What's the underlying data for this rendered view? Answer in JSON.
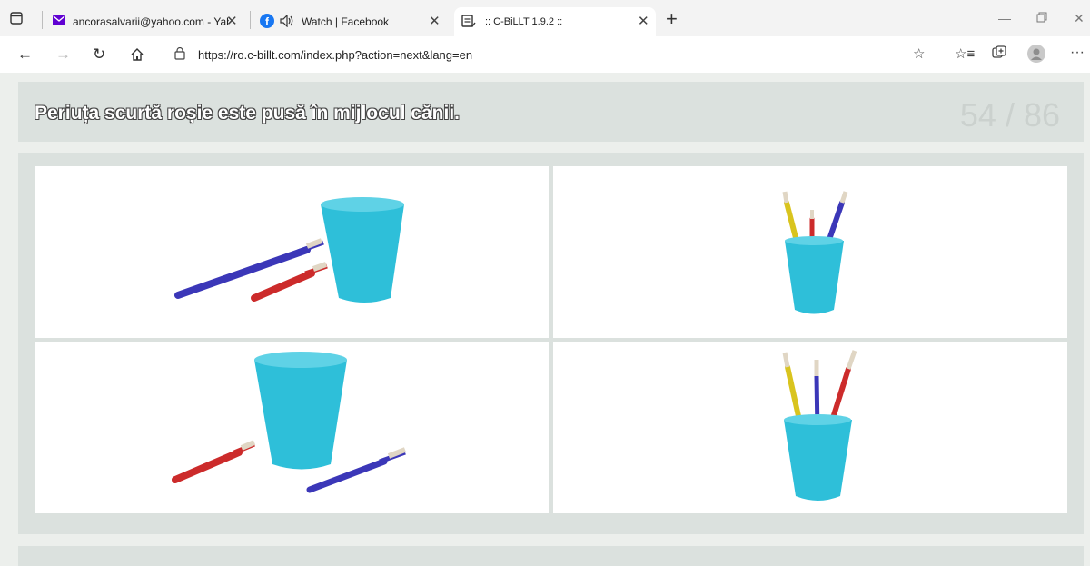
{
  "tabs": [
    {
      "label": "ancorasalvarii@yahoo.com - Yah"
    },
    {
      "label": "Watch | Facebook"
    },
    {
      "label": ":: C-BiLLT 1.9.2 ::"
    }
  ],
  "address": {
    "url": "https://ro.c-billt.com/index.php?action=next&lang=en"
  },
  "question": {
    "sentence": "Periuța scurtă roșie este pusă în mijlocul cănii.",
    "progress": "54 / 86"
  },
  "choices": [
    {
      "id": "top-left",
      "scene": "cup beside red and blue toothbrushes"
    },
    {
      "id": "top-right",
      "scene": "cup with yellow, short red and blue toothbrushes"
    },
    {
      "id": "bottom-left",
      "scene": "cup between red and blue toothbrushes"
    },
    {
      "id": "bottom-right",
      "scene": "cup with yellow, blue and long red toothbrushes"
    }
  ],
  "colors": {
    "cup": "#2ebfd9",
    "brush_red": "#cc2b2b",
    "brush_blue": "#3b37b8",
    "brush_yellow": "#d9c41e",
    "bristle": "#e0d6c4"
  }
}
